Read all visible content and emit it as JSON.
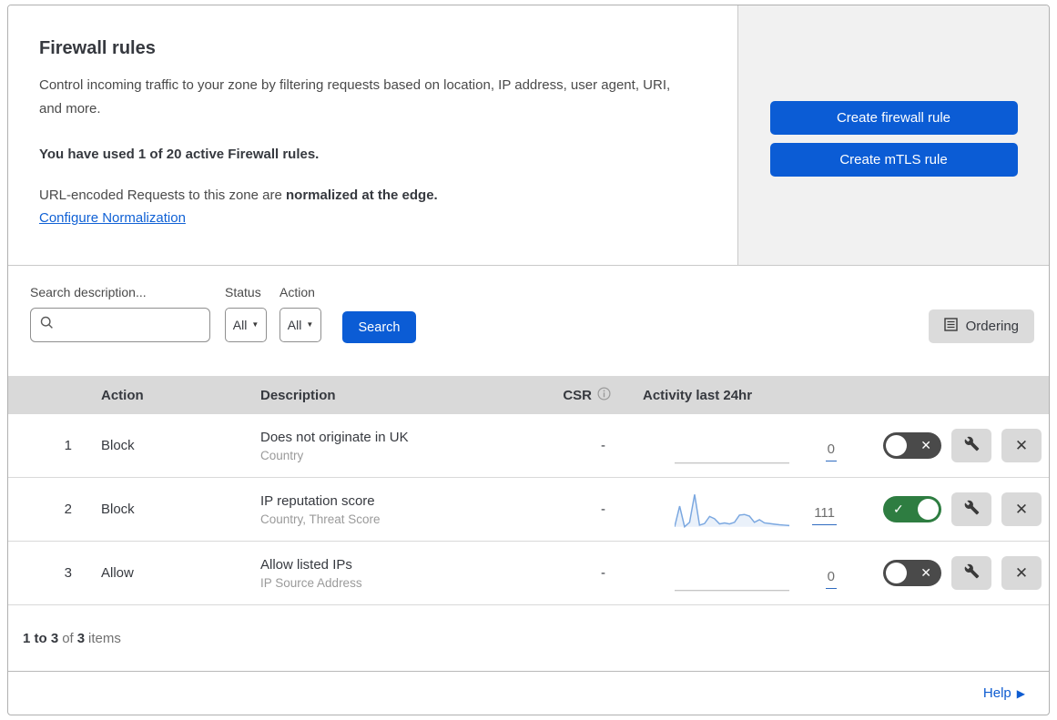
{
  "header": {
    "title": "Firewall rules",
    "description": "Control incoming traffic to your zone by filtering requests based on location, IP address, user agent, URI, and more.",
    "usage_note": "You have used 1 of 20 active Firewall rules.",
    "normalization_prefix": "URL-encoded Requests to this zone are ",
    "normalization_bold": "normalized at the edge.",
    "normalization_link": "Configure Normalization",
    "actions": [
      {
        "label": "Create firewall rule"
      },
      {
        "label": "Create mTLS rule"
      }
    ]
  },
  "filters": {
    "search_label": "Search description...",
    "status_label": "Status",
    "status_value": "All",
    "action_label": "Action",
    "action_value": "All",
    "search_button": "Search",
    "ordering_button": "Ordering"
  },
  "table": {
    "columns": {
      "action": "Action",
      "description": "Description",
      "csr": "CSR",
      "activity": "Activity last 24hr"
    },
    "rows": [
      {
        "number": "1",
        "action": "Block",
        "description": "Does not originate in UK",
        "fields": "Country",
        "csr": "-",
        "activity_count": "0",
        "enabled": false,
        "sparkline": []
      },
      {
        "number": "2",
        "action": "Block",
        "description": "IP reputation score",
        "fields": "Country, Threat Score",
        "csr": "-",
        "activity_count": "111",
        "enabled": true,
        "sparkline": [
          0,
          64,
          0,
          14,
          100,
          5,
          10,
          32,
          25,
          9,
          12,
          9,
          14,
          36,
          38,
          33,
          14,
          22,
          12,
          10,
          8,
          6,
          5,
          4
        ]
      },
      {
        "number": "3",
        "action": "Allow",
        "description": "Allow listed IPs",
        "fields": "IP Source Address",
        "csr": "-",
        "activity_count": "0",
        "enabled": false,
        "sparkline": []
      }
    ]
  },
  "pagination": {
    "range": "1 to 3",
    "of": "of",
    "total": "3",
    "items": "items"
  },
  "help": {
    "label": "Help"
  },
  "glyphs": {
    "check": "✓",
    "cross": "✕",
    "caret": "▼",
    "help_arrow": "▶"
  },
  "colors": {
    "primary_blue": "#0b5cd5",
    "link_blue": "#1061d5",
    "toggle_on_green": "#2e7d41",
    "toggle_off_gray": "#4a4a4a",
    "sparkline_blue": "#7aa7e0",
    "header_band_gray": "#d9d9d9",
    "panel_gray": "#f1f1f1"
  }
}
